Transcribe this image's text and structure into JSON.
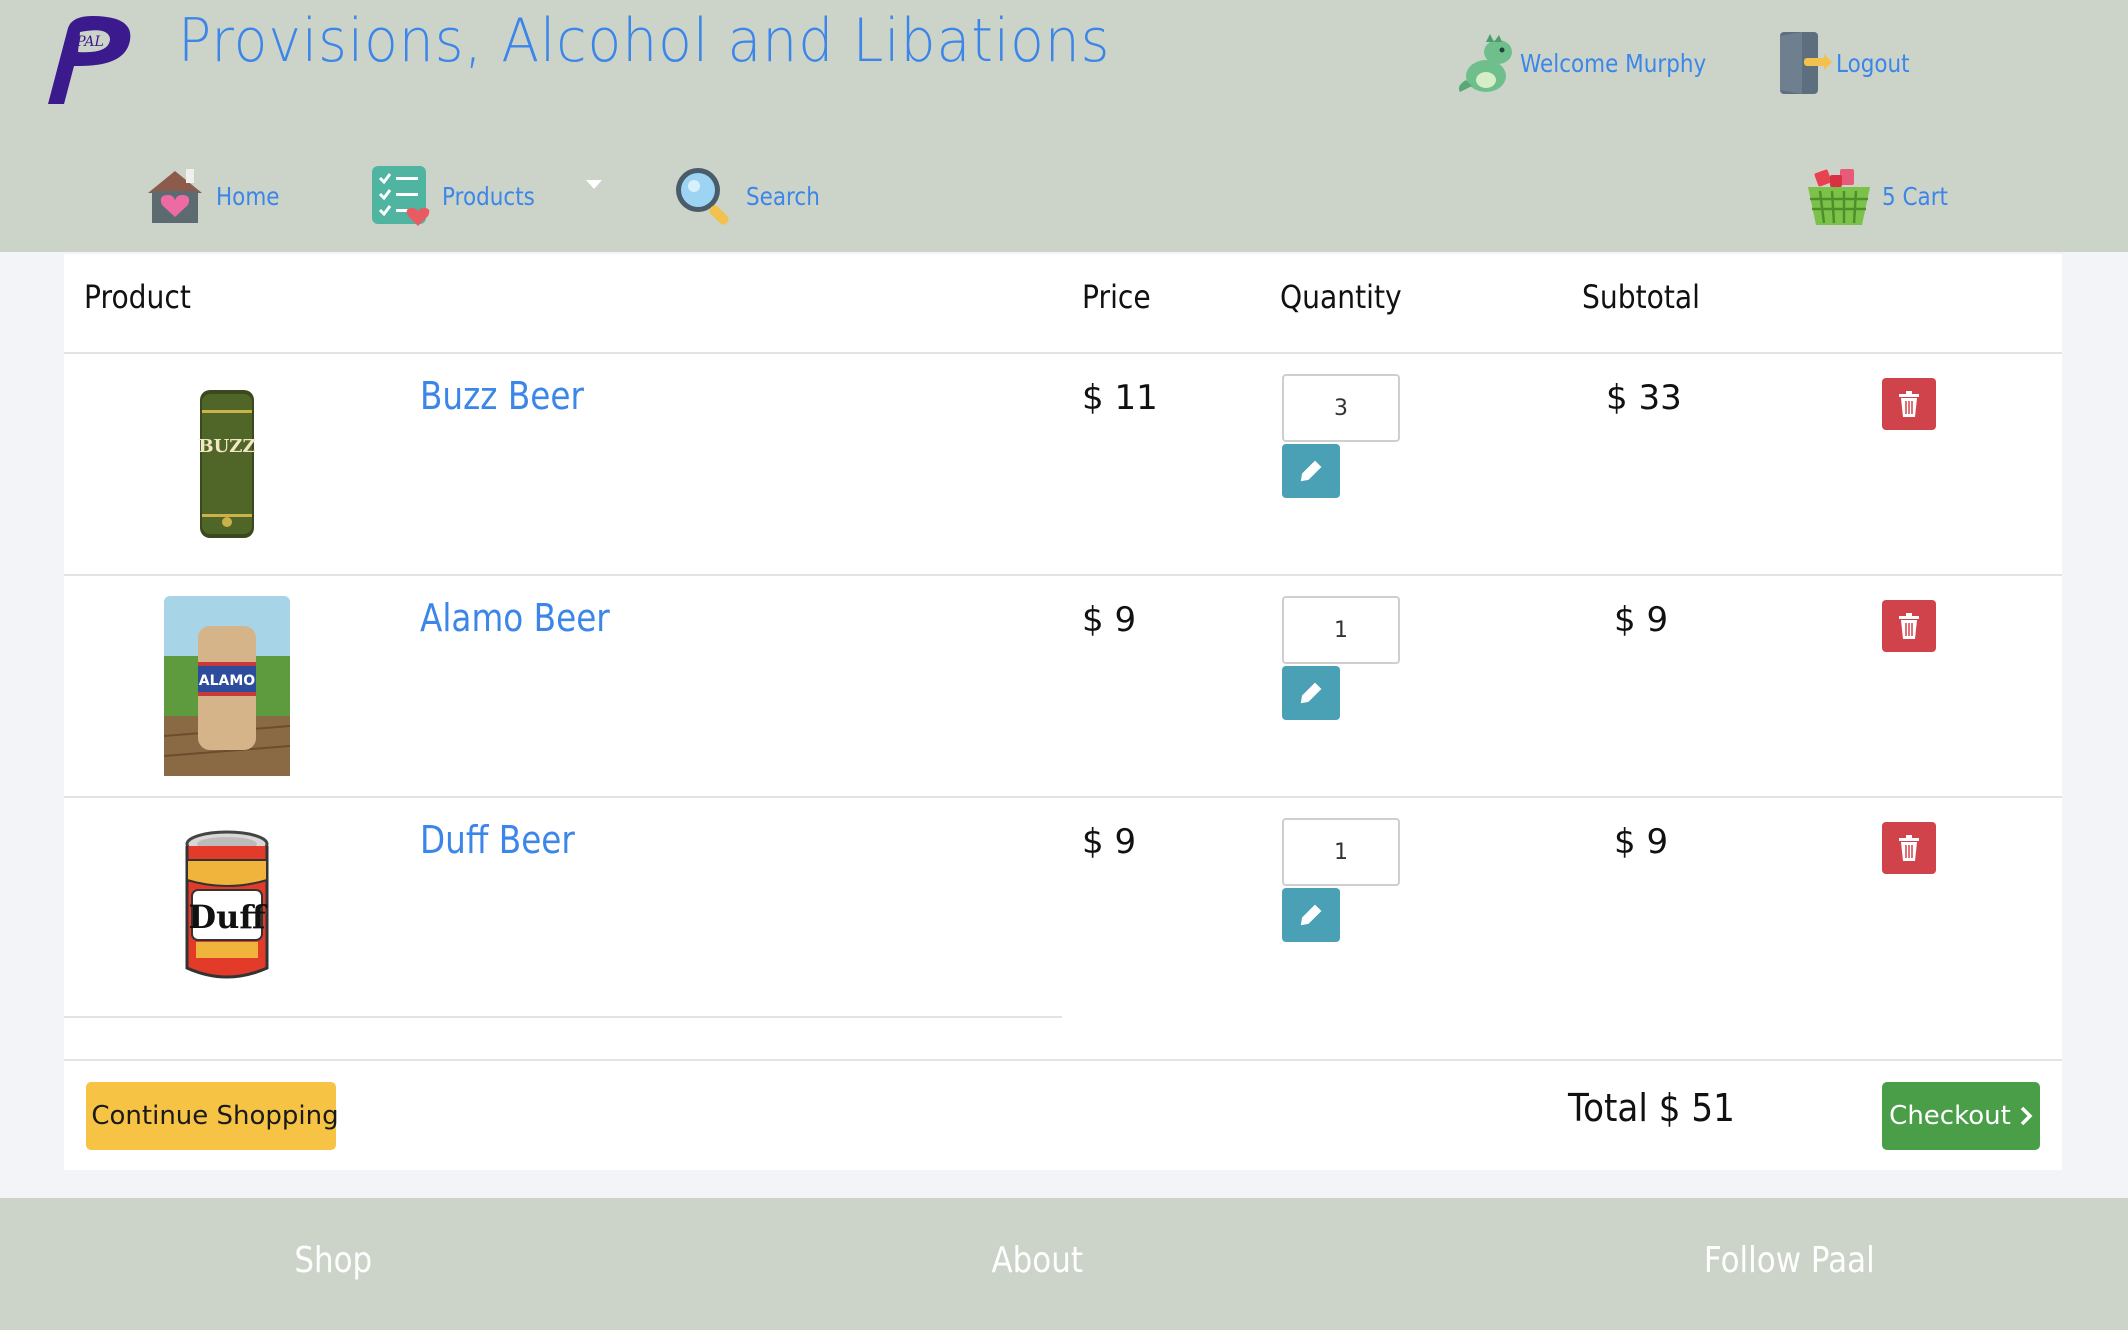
{
  "site": {
    "title": "Provisions, Alcohol and Libations",
    "logo_text": "PAL",
    "brand_color": "#3b86e8",
    "header_bg": "#ccd4ca"
  },
  "user": {
    "welcome": "Welcome Murphy",
    "logout_label": "Logout",
    "avatar_icon": "dinosaur-icon",
    "logout_icon": "door-exit-icon"
  },
  "nav": {
    "home": {
      "label": "Home",
      "icon": "house-heart-icon"
    },
    "products": {
      "label": "Products",
      "icon": "checklist-heart-icon"
    },
    "search": {
      "label": "Search",
      "icon": "magnifier-icon"
    },
    "cart": {
      "label": "5 Cart",
      "icon": "basket-icon"
    }
  },
  "cart": {
    "columns": {
      "product": "Product",
      "price": "Price",
      "quantity": "Quantity",
      "subtotal": "Subtotal"
    },
    "items": [
      {
        "name": "Buzz Beer",
        "price": "$ 11",
        "quantity": "3",
        "subtotal": "$ 33",
        "image": "buzz-beer-can",
        "image_text": "BUZZ"
      },
      {
        "name": "Alamo Beer",
        "price": "$ 9",
        "quantity": "1",
        "subtotal": "$ 9",
        "image": "alamo-beer-can",
        "image_text": "ALAMO"
      },
      {
        "name": "Duff Beer",
        "price": "$ 9",
        "quantity": "1",
        "subtotal": "$ 9",
        "image": "duff-beer-can",
        "image_text": "Duff"
      }
    ],
    "continue_label": "Continue Shopping",
    "total_label": "Total $ 51",
    "checkout_label": "Checkout",
    "colors": {
      "edit": "#4aa0b5",
      "delete": "#d0434a",
      "continue": "#f6c345",
      "checkout": "#4a9e48"
    }
  },
  "footer": {
    "shop": "Shop",
    "about": "About",
    "follow": "Follow Paal"
  }
}
